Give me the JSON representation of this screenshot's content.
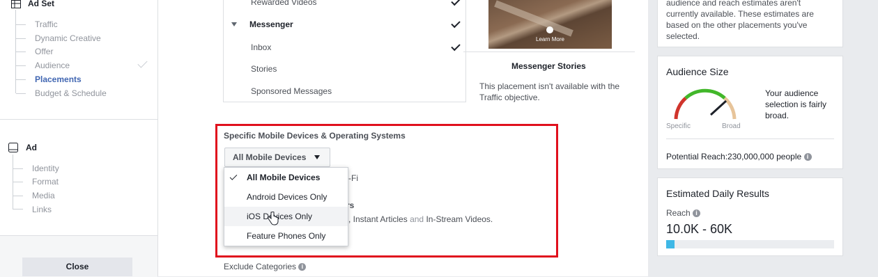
{
  "sidebar": {
    "adset_title": "Ad Set",
    "adset_items": [
      "Traffic",
      "Dynamic Creative",
      "Offer",
      "Audience",
      "Placements",
      "Budget & Schedule"
    ],
    "ad_title": "Ad",
    "ad_items": [
      "Identity",
      "Format",
      "Media",
      "Links"
    ],
    "close_label": "Close"
  },
  "placements": {
    "rows": [
      {
        "label": "Rewarded Videos",
        "checked": true
      },
      {
        "label": "Messenger",
        "checked": true,
        "group": true
      },
      {
        "label": "Inbox",
        "checked": true
      },
      {
        "label": "Stories",
        "checked": false
      },
      {
        "label": "Sponsored Messages",
        "checked": false
      }
    ]
  },
  "preview": {
    "learn_more": "Learn More",
    "title": "Messenger Stories",
    "note": "This placement isn't available with the Traffic objective."
  },
  "devices": {
    "section_title": "Specific Mobile Devices & Operating Systems",
    "selected": "All Mobile Devices",
    "options": [
      "All Mobile Devices",
      "Android Devices Only",
      "iOS Devices Only",
      "Feature Phones Only"
    ],
    "wifi_fragment": "-Fi",
    "publishers_fragment": "rs",
    "articles_text": "Instant Articles",
    "and_text": "and",
    "instream_text": "In-Stream Videos."
  },
  "exclude": {
    "label": "Exclude Categories"
  },
  "right": {
    "estimate_note_line1": "audience and reach estimates aren't",
    "estimate_note_line2": "currently available. These estimates are",
    "estimate_note_line3": "based on the other placements you've",
    "estimate_note_line4": "selected.",
    "audience_size": {
      "title": "Audience Size",
      "desc_line1": "Your audience",
      "desc_line2": "selection is fairly",
      "desc_line3": "broad.",
      "specific": "Specific",
      "broad": "Broad",
      "potential_reach": "Potential Reach:230,000,000 people"
    },
    "daily_results": {
      "title": "Estimated Daily Results",
      "reach_label": "Reach",
      "reach_value": "10.0K - 60K",
      "bar_fill_fraction": 0.05
    }
  },
  "colors": {
    "accent": "#4267b2",
    "highlight": "#e0101d",
    "gauge_green": "#42b72a",
    "gauge_red": "#d0342c"
  }
}
